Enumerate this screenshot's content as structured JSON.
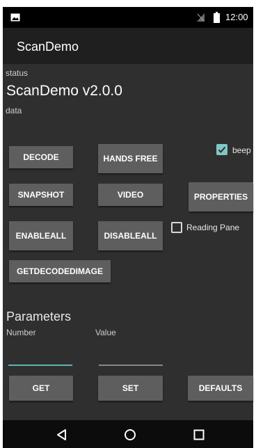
{
  "status_bar": {
    "time": "12:00",
    "icons": [
      "image-icon",
      "signal-off-icon",
      "battery-icon"
    ]
  },
  "app_bar": {
    "title": "ScanDemo"
  },
  "main": {
    "status_label": "status",
    "version": "ScanDemo v2.0.0",
    "data_label": "data",
    "buttons": {
      "decode": "DECODE",
      "hands_free": "HANDS FREE",
      "snapshot": "SNAPSHOT",
      "video": "VIDEO",
      "properties": "PROPERTIES",
      "enable_all": "ENABLEALL",
      "disable_all": "DISABLEALL",
      "get_decoded_image": "GETDECODEDIMAGE"
    },
    "beep": {
      "label": "beep",
      "checked": true
    },
    "reading_pane": {
      "label": "Reading Pane",
      "checked": false
    }
  },
  "parameters": {
    "heading": "Parameters",
    "number_label": "Number",
    "number_value": "",
    "value_label": "Value",
    "value_value": "",
    "get_label": "GET",
    "set_label": "SET",
    "defaults_label": "DEFAULTS"
  },
  "nav_bar": {
    "icons": [
      "back-icon",
      "home-icon",
      "recents-icon"
    ]
  },
  "colors": {
    "accent": "#7ec7c4",
    "background": "#2f2f2f",
    "button": "#5e5e5e",
    "app_bar": "#1f1f1f"
  }
}
